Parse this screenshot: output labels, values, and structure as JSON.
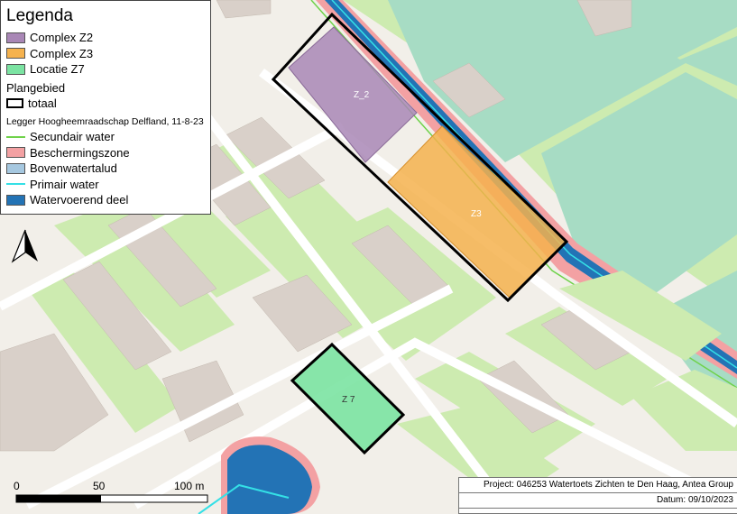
{
  "legend": {
    "title": "Legenda",
    "items": [
      {
        "label": "Complex Z2",
        "color": "#a987b6"
      },
      {
        "label": "Complex Z3",
        "color": "#f5b24e"
      },
      {
        "label": "Locatie Z7",
        "color": "#7be3a2"
      }
    ],
    "plangebied_heading": "Plangebied",
    "plangebied_item": "totaal",
    "source_heading": "Legger Hoogheemraadschap Delfland, 11-8-23",
    "water_items": [
      {
        "label": "Secundair water",
        "color": "#6fd24a",
        "kind": "line"
      },
      {
        "label": "Beschermingszone",
        "color": "#f3a1a3",
        "kind": "fill"
      },
      {
        "label": "Bovenwatertalud",
        "color": "#a6c8e0",
        "kind": "fill"
      },
      {
        "label": "Primair water",
        "color": "#34e0e6",
        "kind": "line"
      },
      {
        "label": "Watervoerend deel",
        "color": "#2373b5",
        "kind": "fill"
      }
    ]
  },
  "map": {
    "areas": [
      {
        "label": "Z_2",
        "color": "#a987b6"
      },
      {
        "label": "Z3",
        "color": "#f5b24e"
      },
      {
        "label": "Z 7",
        "color": "#7be3a2"
      }
    ]
  },
  "scalebar": {
    "labels": [
      "0",
      "50",
      "100 m"
    ]
  },
  "project": {
    "line1": "Project: 046253 Watertoets Zichten te Den Haag, Antea Group",
    "line2": "Datum: 09/10/2023"
  }
}
